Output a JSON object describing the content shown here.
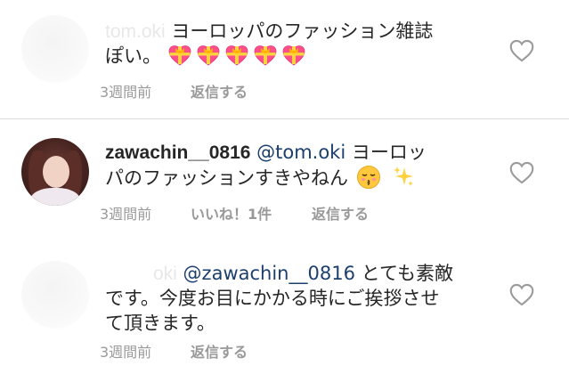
{
  "comments": [
    {
      "username": "tom.oki",
      "line1": "ヨーロッパのファッション雑誌",
      "line2": "ぽい。",
      "emoji_names": [
        "heart-with-ribbon-emoji",
        "heart-with-ribbon-emoji",
        "heart-with-ribbon-emoji",
        "heart-with-ribbon-emoji",
        "heart-with-ribbon-emoji"
      ],
      "time": "3週間前",
      "reply": "返信する"
    },
    {
      "username": "zawachin__0816",
      "mention": "@tom.oki",
      "line1_text": "ヨーロッ",
      "line2": "パのファッションすきやねん",
      "emoji_names": [
        "kissing-face-emoji",
        "sparkles-emoji"
      ],
      "time": "3週間前",
      "likes": "いいね！1件",
      "reply": "返信する"
    },
    {
      "username": "oki",
      "mention": "@zawachin__0816",
      "line1_text": "とても素敵",
      "line2": "です。今度お目にかかる時にご挨拶させ",
      "line3": "て頂きます。",
      "time": "3週間前",
      "reply": "返信する"
    }
  ],
  "colors": {
    "heart_outline": "#9b9b9b",
    "mention": "#1c3f6e",
    "meta_text": "#999999",
    "divider": "#dbdbdb"
  }
}
